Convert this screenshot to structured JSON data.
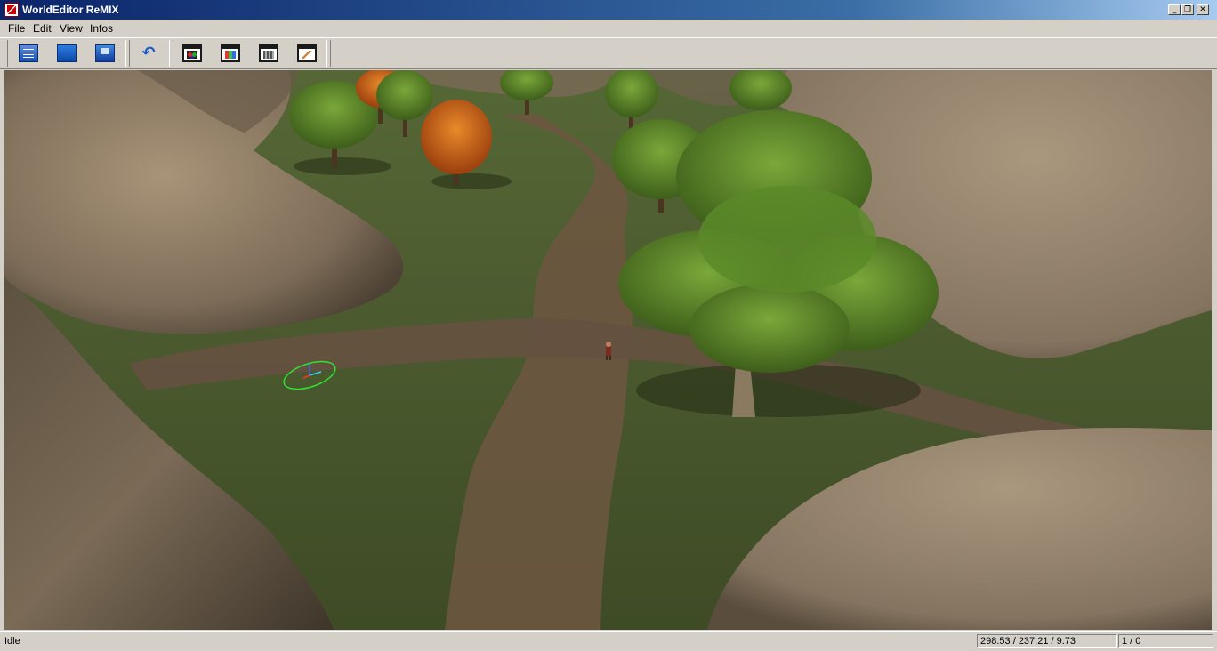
{
  "window": {
    "title": "WorldEditor ReMIX",
    "controls": {
      "minimize": "_",
      "restore": "❐",
      "close": "✕"
    }
  },
  "menu": [
    "File",
    "Edit",
    "View",
    "Infos"
  ],
  "toolbar": {
    "buttons": [
      {
        "name": "new-button",
        "icon": "document-icon"
      },
      {
        "name": "open-button",
        "icon": "folder-icon"
      },
      {
        "name": "save-button",
        "icon": "monitor-save-icon"
      },
      {
        "name": "undo-button",
        "icon": "undo-arrow-icon"
      },
      {
        "name": "window-button-1",
        "icon": "palette-window-icon"
      },
      {
        "name": "window-button-2",
        "icon": "texture-window-icon"
      },
      {
        "name": "window-button-3",
        "icon": "grid-window-icon"
      },
      {
        "name": "window-button-4",
        "icon": "brush-window-icon"
      }
    ],
    "undo_glyph": "↶"
  },
  "status": {
    "state": "Idle",
    "coordinates": "298.53 / 237.21 / 9.73",
    "counter": "1 / 0"
  },
  "colors": {
    "title_start": "#0a246a",
    "title_end": "#a6caf0",
    "chrome": "#d4d0c8",
    "grass": "#4a5a2e",
    "dirt": "#6b5640",
    "rock": "#8a7a68",
    "tree_green": "#5f8a2c",
    "tree_orange": "#c8621a",
    "selection_ring": "#2fe02f"
  }
}
